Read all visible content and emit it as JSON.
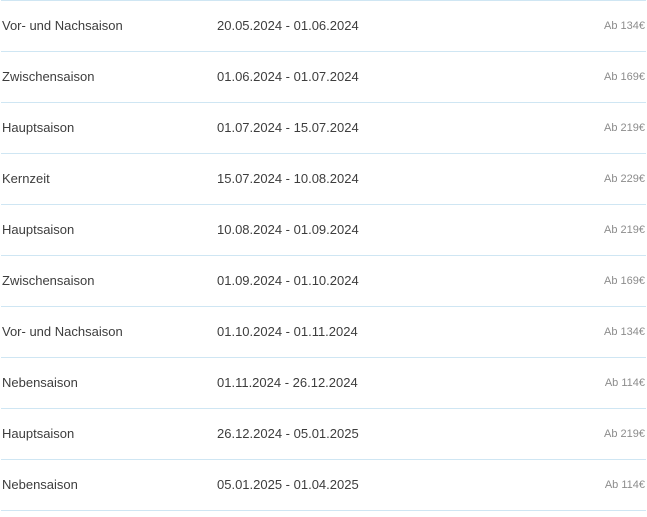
{
  "seasons": [
    {
      "name": "Vor- und Nachsaison",
      "dates": "20.05.2024 - 01.06.2024",
      "price": "Ab 134€"
    },
    {
      "name": "Zwischensaison",
      "dates": "01.06.2024 - 01.07.2024",
      "price": "Ab 169€"
    },
    {
      "name": "Hauptsaison",
      "dates": "01.07.2024 - 15.07.2024",
      "price": "Ab 219€"
    },
    {
      "name": "Kernzeit",
      "dates": "15.07.2024 - 10.08.2024",
      "price": "Ab 229€"
    },
    {
      "name": "Hauptsaison",
      "dates": "10.08.2024 - 01.09.2024",
      "price": "Ab 219€"
    },
    {
      "name": "Zwischensaison",
      "dates": "01.09.2024 - 01.10.2024",
      "price": "Ab 169€"
    },
    {
      "name": "Vor- und Nachsaison",
      "dates": "01.10.2024 - 01.11.2024",
      "price": "Ab 134€"
    },
    {
      "name": "Nebensaison",
      "dates": "01.11.2024 - 26.12.2024",
      "price": "Ab 114€"
    },
    {
      "name": "Hauptsaison",
      "dates": "26.12.2024 - 05.01.2025",
      "price": "Ab 219€"
    },
    {
      "name": "Nebensaison",
      "dates": "05.01.2025 - 01.04.2025",
      "price": "Ab 114€"
    }
  ]
}
